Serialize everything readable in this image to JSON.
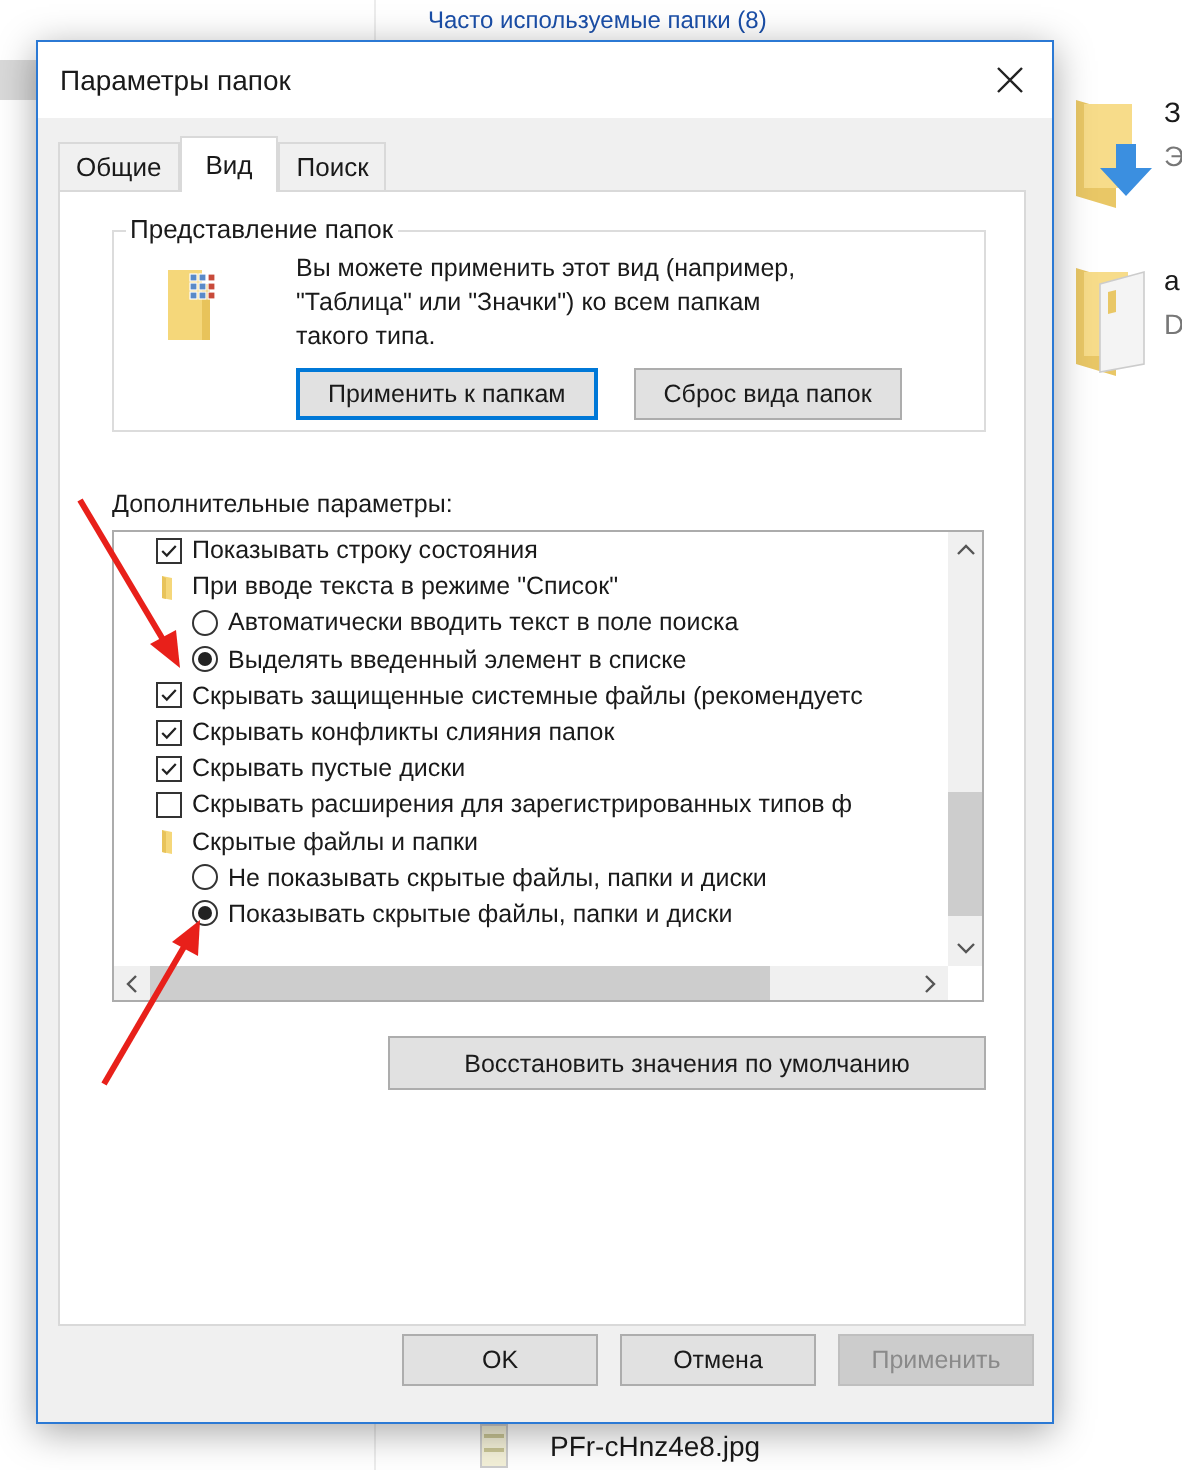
{
  "explorer": {
    "group_header": "Часто используемые папки (8)",
    "items": [
      {
        "name": "З",
        "detail": "Э"
      },
      {
        "name": "а",
        "detail": "D"
      }
    ],
    "file": "PFr-cHnz4e8.jpg"
  },
  "window": {
    "title": "Параметры папок"
  },
  "tabs": [
    {
      "label": "Общие",
      "selected": false
    },
    {
      "label": "Вид",
      "selected": true
    },
    {
      "label": "Поиск",
      "selected": false
    }
  ],
  "folder_views": {
    "title": "Представление папок",
    "description": "Вы можете применить этот вид (например, \"Таблица\" или \"Значки\") ко всем папкам такого типа.",
    "buttons": [
      {
        "label": "Применить к папкам",
        "focused": true
      },
      {
        "label": "Сброс вида папок",
        "focused": false
      }
    ]
  },
  "advanced": {
    "title": "Дополнительные параметры:",
    "items": [
      {
        "kind": "checkbox",
        "label": "Показывать строку состояния",
        "checked": true
      },
      {
        "kind": "folder",
        "label": "При вводе текста в режиме \"Список\"",
        "children": [
          {
            "kind": "radio",
            "label": "Автоматически вводить текст в поле поиска",
            "selected": false
          },
          {
            "kind": "radio",
            "label": "Выделять введенный элемент в списке",
            "selected": true
          }
        ]
      },
      {
        "kind": "checkbox",
        "label": "Скрывать защищенные системные файлы (рекомендуетс",
        "checked": true
      },
      {
        "kind": "checkbox",
        "label": "Скрывать конфликты слияния папок",
        "checked": true
      },
      {
        "kind": "checkbox",
        "label": "Скрывать пустые диски",
        "checked": true
      },
      {
        "kind": "checkbox",
        "label": "Скрывать расширения для зарегистрированных типов ф",
        "checked": false
      },
      {
        "kind": "folder",
        "label": "Скрытые файлы и папки",
        "children": [
          {
            "kind": "radio",
            "label": "Не показывать скрытые файлы, папки и диски",
            "selected": false
          },
          {
            "kind": "radio",
            "label": "Показывать скрытые файлы, папки и диски",
            "selected": true
          }
        ]
      }
    ]
  },
  "restore_button": "Восстановить значения по умолчанию",
  "buttons": [
    {
      "label": "OK",
      "disabled": false
    },
    {
      "label": "Отмена",
      "disabled": false
    },
    {
      "label": "Применить",
      "disabled": true
    }
  ]
}
